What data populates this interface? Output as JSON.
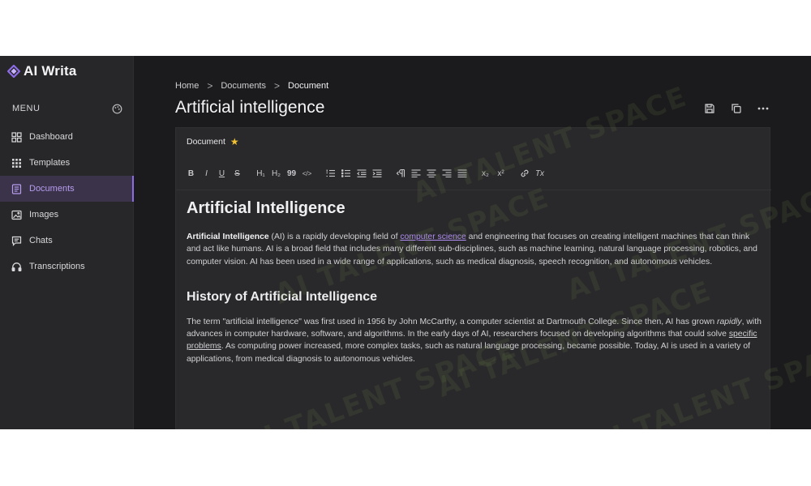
{
  "app": {
    "name": "AI Writa"
  },
  "sidebar": {
    "menu_label": "MENU",
    "items": [
      {
        "label": "Dashboard",
        "icon": "dashboard-icon",
        "active": false
      },
      {
        "label": "Templates",
        "icon": "templates-grid-icon",
        "active": false
      },
      {
        "label": "Documents",
        "icon": "documents-icon",
        "active": true
      },
      {
        "label": "Images",
        "icon": "image-icon",
        "active": false
      },
      {
        "label": "Chats",
        "icon": "chat-icon",
        "active": false
      },
      {
        "label": "Transcriptions",
        "icon": "headphones-icon",
        "active": false
      }
    ]
  },
  "breadcrumb": {
    "home": "Home",
    "section": "Documents",
    "current": "Document",
    "separator": ">"
  },
  "page": {
    "title": "Artificial intelligence"
  },
  "document": {
    "label": "Document",
    "star": "★"
  },
  "toolbar": {
    "bold": "B",
    "italic": "I",
    "underline": "U",
    "strike": "S",
    "h1": "H₁",
    "h2": "H₂",
    "quote": "99",
    "code": "</>",
    "subscript": "x₂",
    "superscript": "x²",
    "clear": "Tx"
  },
  "content": {
    "heading": "Artificial Intelligence",
    "p1": {
      "bold": "Artificial Intelligence",
      "t1": " (AI) is a rapidly developing field of ",
      "link": "computer science",
      "t2": " and engineering that focuses on creating intelligent machines that can think and act like humans. AI is a broad field that includes many different sub-disciplines, such as machine learning, natural language processing, robotics, and computer vision. AI has been used in a wide range of applications, such as medical diagnosis, speech recognition, and autonomous vehicles."
    },
    "subheading": "History of Artificial Intelligence",
    "p2": {
      "t1": "The term \"artificial intelligence\" was first used in 1956 by John McCarthy, a computer scientist at Dartmouth College. Since then, AI has grown ",
      "italic": "rapidly",
      "t2": ", with advances in computer hardware, software, and algorithms. In the early days of AI, researchers focused on developing algorithms that could solve ",
      "underline": "specific problems",
      "t3": ". As computing power increased, more complex tasks, such as natural language processing, became possible. Today, AI is used in a variety of applications, from medical diagnosis to autonomous vehicles."
    }
  },
  "watermark": {
    "text": "AI TALENT SPACE"
  },
  "colors": {
    "accent": "#8b6ce6",
    "link": "#b08df2",
    "star": "#f1c232",
    "background": "#1b1b1d",
    "sidebar": "#272729"
  }
}
